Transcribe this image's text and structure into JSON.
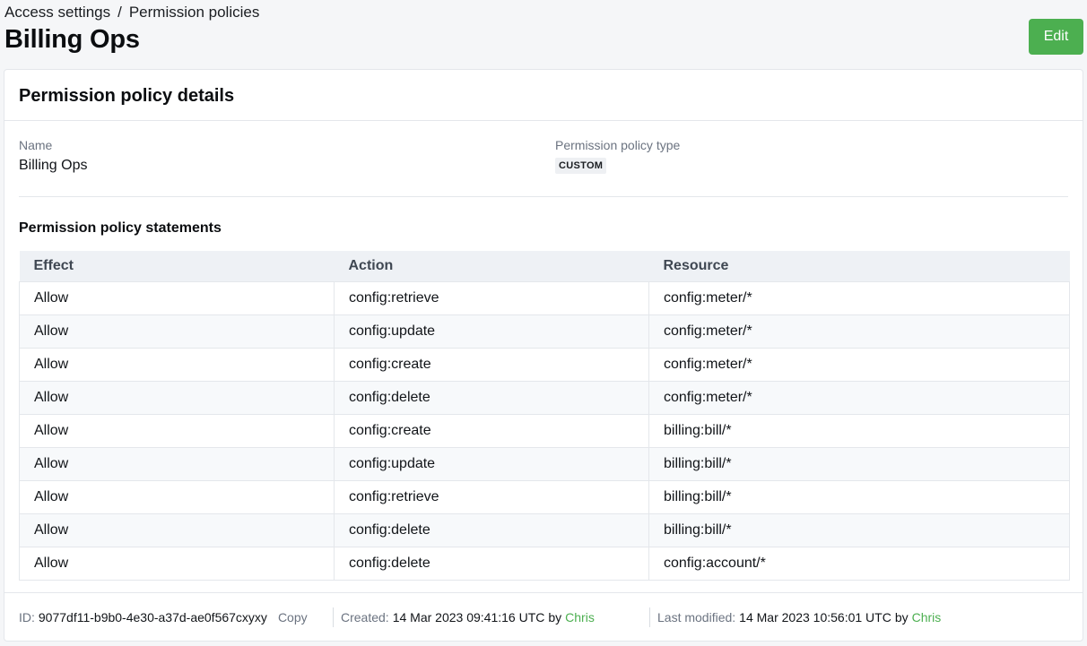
{
  "breadcrumb": {
    "parent": "Access settings",
    "separator": "/",
    "current": "Permission policies"
  },
  "page": {
    "title": "Billing Ops",
    "edit_label": "Edit"
  },
  "details": {
    "heading": "Permission policy details",
    "name_label": "Name",
    "name_value": "Billing Ops",
    "type_label": "Permission policy type",
    "type_value": "CUSTOM"
  },
  "statements": {
    "heading": "Permission policy statements",
    "columns": [
      "Effect",
      "Action",
      "Resource"
    ],
    "rows": [
      [
        "Allow",
        "config:retrieve",
        "config:meter/*"
      ],
      [
        "Allow",
        "config:update",
        "config:meter/*"
      ],
      [
        "Allow",
        "config:create",
        "config:meter/*"
      ],
      [
        "Allow",
        "config:delete",
        "config:meter/*"
      ],
      [
        "Allow",
        "config:create",
        "billing:bill/*"
      ],
      [
        "Allow",
        "config:update",
        "billing:bill/*"
      ],
      [
        "Allow",
        "config:retrieve",
        "billing:bill/*"
      ],
      [
        "Allow",
        "config:delete",
        "billing:bill/*"
      ],
      [
        "Allow",
        "config:delete",
        "config:account/*"
      ]
    ]
  },
  "footer": {
    "id_label": "ID:",
    "id_value": "9077df11-b9b0-4e30-a37d-ae0f567cxyxy",
    "copy_label": "Copy",
    "created_label": "Created:",
    "created_value": "14 Mar 2023 09:41:16 UTC",
    "created_by_word": "by",
    "created_by": "Chris",
    "modified_label": "Last modified:",
    "modified_value": "14 Mar 2023 10:56:01 UTC",
    "modified_by_word": "by",
    "modified_by": "Chris"
  },
  "colors": {
    "accent": "#4caf50",
    "header_bg": "#eef1f5"
  }
}
